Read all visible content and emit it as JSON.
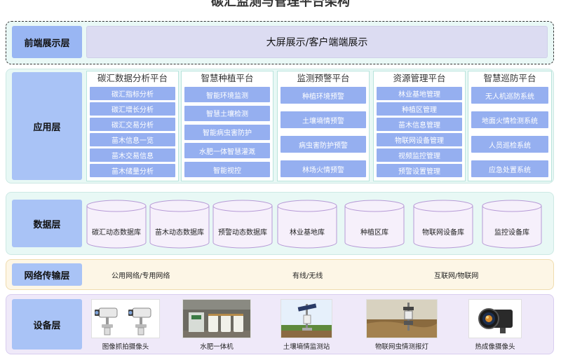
{
  "title": "碳汇监测与管理平台架构",
  "front_layer": {
    "label": "前端展示层",
    "content": "大屏展示/客户端端展示"
  },
  "app_layer": {
    "label": "应用层",
    "platforms": [
      {
        "title": "碳汇数据分析平台",
        "items": [
          "碳汇指标分析",
          "碳汇增长分析",
          "碳汇交易分析",
          "苗木信息一览",
          "苗木交易信息",
          "苗木储量分析"
        ]
      },
      {
        "title": "智慧种植平台",
        "items": [
          "智能环境监测",
          "智慧土壤检测",
          "智能病虫害防护",
          "水肥一体智慧灌溉",
          "智能视控"
        ]
      },
      {
        "title": "监测预警平台",
        "items": [
          "种植环境预警",
          "土壤墒情预警",
          "病虫害防护预警",
          "林场火情预警"
        ]
      },
      {
        "title": "资源管理平台",
        "items": [
          "林业基地管理",
          "种植区管理",
          "苗木信息管理",
          "物联网设备管理",
          "视频监控管理",
          "预警设置管理"
        ]
      },
      {
        "title": "智慧巡防平台",
        "items": [
          "无人机巡防系统",
          "地面火情检测系统",
          "人员巡检系统",
          "应急处置系统"
        ]
      }
    ]
  },
  "data_layer": {
    "label": "数据层",
    "databases": [
      "碳汇动态数据库",
      "苗木动态数据库",
      "预警动态数据库",
      "林业基地库",
      "种植区库",
      "物联网设备库",
      "监控设备库"
    ]
  },
  "network_layer": {
    "label": "网络传输层",
    "items": [
      "公用网络/专用网络",
      "有线/无线",
      "互联网/物联网"
    ]
  },
  "device_layer": {
    "label": "设备层",
    "devices": [
      {
        "name": "图像抓拍摄像头",
        "icon": "camera-pair-icon"
      },
      {
        "name": "水肥一体机",
        "icon": "irrigation-machine-icon"
      },
      {
        "name": "土壤墒情监测站",
        "icon": "soil-station-icon"
      },
      {
        "name": "物联网虫情测报灯",
        "icon": "pest-lamp-icon"
      },
      {
        "name": "热成像摄像头",
        "icon": "thermal-camera-icon"
      }
    ]
  },
  "colors": {
    "accent": "#95aff0",
    "label_bg": "#a9c3f6",
    "app_bg": "#e8f8f5",
    "net_bg": "#fdf6e6",
    "dev_bg": "#efe9f9"
  }
}
